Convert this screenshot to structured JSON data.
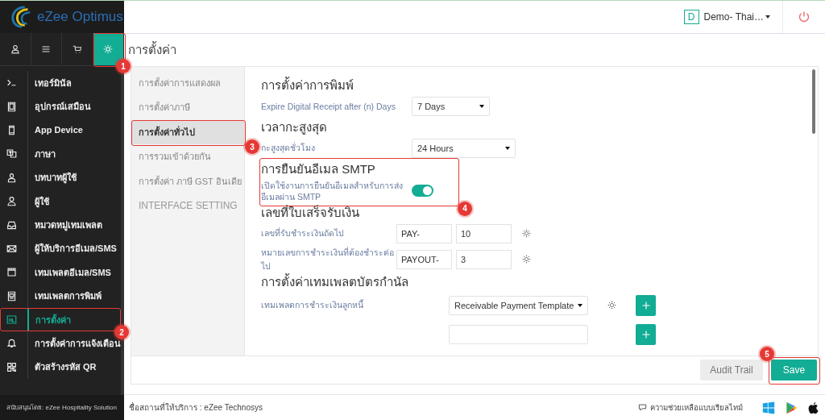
{
  "header": {
    "logo_text": "eZee Optimus",
    "property_initial": "D",
    "property_name": "Demo- Thai…"
  },
  "top_tabs": [
    {
      "kind": "user",
      "selected": false
    },
    {
      "kind": "menu",
      "selected": false
    },
    {
      "kind": "cart",
      "selected": false
    },
    {
      "kind": "gear",
      "selected": true,
      "annotation": "1"
    }
  ],
  "page_title": "การตั้งค่า",
  "sidebar": {
    "items": [
      {
        "kind": "terminal",
        "label": "เทอร์มินัล",
        "selected": false
      },
      {
        "kind": "tablet",
        "label": "อุปกรณ์เสมือน",
        "selected": false
      },
      {
        "kind": "phone",
        "label": "App Device",
        "selected": false
      },
      {
        "kind": "language",
        "label": "ภาษา",
        "selected": false
      },
      {
        "kind": "user-solid",
        "label": "บทบาทผู้ใช้",
        "selected": false
      },
      {
        "kind": "user",
        "label": "ผู้ใช้",
        "selected": false
      },
      {
        "kind": "tray",
        "label": "หมวดหมู่เทมเพลต",
        "selected": false
      },
      {
        "kind": "envelope",
        "label": "ผู้ให้บริการอีเมล/SMS",
        "selected": false
      },
      {
        "kind": "calendar",
        "label": "เทมเพลตอีเมล/SMS",
        "selected": false
      },
      {
        "kind": "document",
        "label": "เทมเพลตการพิมพ์",
        "selected": false
      },
      {
        "kind": "settings",
        "label": "การตั้งค่า",
        "selected": true,
        "annotation": "2"
      },
      {
        "kind": "bell",
        "label": "การตั้งค่าการแจ้งเตือน",
        "selected": false
      },
      {
        "kind": "qr",
        "label": "ตัวสร้างรหัส QR",
        "selected": false
      }
    ],
    "footer": "สนับสนุนโดย: eZee Hospitality Solution"
  },
  "subnav": [
    {
      "label": "การตั้งค่าการแสดงผล",
      "selected": false
    },
    {
      "label": "การตั้งค่าภาษี",
      "selected": false
    },
    {
      "label": "การตั้งค่าทั่วไป",
      "selected": true,
      "annotation": "3"
    },
    {
      "label": "การรวมเข้าด้วยกัน",
      "selected": false
    },
    {
      "label": "การตั้งค่า ภาษี GST อินเดีย",
      "selected": false
    },
    {
      "label": "INTERFACE SETTING",
      "selected": false
    }
  ],
  "sections": [
    {
      "title": "การตั้งค่าการพิมพ์",
      "rows": [
        {
          "kind": "select",
          "label": "Expire Digital Receipt after (n) Days",
          "value": "7 Days"
        }
      ]
    },
    {
      "title": "เวลากะสูงสุด",
      "rows": [
        {
          "kind": "select",
          "label": "กะสูงสุดชั่วโมง",
          "value": "24 Hours"
        }
      ]
    },
    {
      "title": "การยืนยันอีเมล SMTP",
      "annotation": "4",
      "rows": [
        {
          "kind": "toggle",
          "label": "เปิดใช้งานการยืนยันอีเมลสำหรับการส่งอีเมลผ่าน SMTP",
          "on": true
        }
      ]
    },
    {
      "title": "เลขที่ใบเสร็จรับเงิน",
      "rows": [
        {
          "kind": "number",
          "label": "เลขที่รับชำระเงินถัดไป",
          "prefix": "PAY-",
          "value": "10"
        },
        {
          "kind": "number",
          "label": "หมายเลขการชำระเงินที่ต้องชำระต่อไป",
          "prefix": "PAYOUT-",
          "value": "3"
        }
      ]
    },
    {
      "title": "การตั้งค่าเทมเพลตบัตรกำนัล",
      "rows": [
        {
          "kind": "template",
          "label": "เทมเพลตการชำระเงินลูกหนี้",
          "value": "Receivable Payment Template"
        },
        {
          "kind": "template"
        }
      ]
    }
  ],
  "buttons": [
    {
      "kind": "secondary",
      "label": "Audit Trail"
    },
    {
      "kind": "primary",
      "label": "Save",
      "annotation": "5"
    }
  ],
  "status_bar": {
    "provider": "ชื่อสถานที่ให้บริการ : eZee Technosys",
    "help": "ความช่วยเหลือแบบเรียลไทม์"
  }
}
